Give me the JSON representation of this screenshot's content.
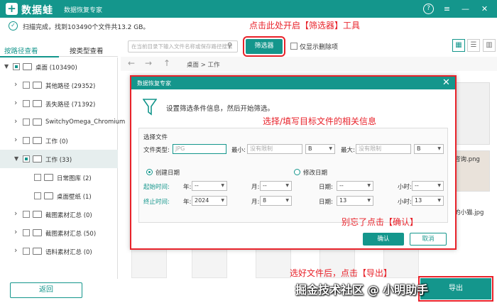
{
  "app": {
    "name": "数据蛙",
    "subtitle": "数据恢复专家",
    "logo_glyph": "+",
    "accent": "#14968c",
    "annotation_color": "#e8222a"
  },
  "window_controls": {
    "help": "?",
    "menu": "≡",
    "minimize": "—",
    "close": "✕"
  },
  "scan": {
    "status": "扫描完成，找到103490个文件共13.2 GB。"
  },
  "annotations": {
    "filter_hint": "点击此处开启【筛选器】工具",
    "fill_hint": "选择/填写目标文件的相关信息",
    "confirm_hint": "别忘了点击【确认】",
    "export_hint": "选好文件后，点击【导出】"
  },
  "watermark": "掘金技术社区 @ 小明助手",
  "sidebar": {
    "tabs": [
      {
        "label": "按路径查看",
        "active": true
      },
      {
        "label": "按类型查看",
        "active": false
      }
    ],
    "tree": [
      {
        "label": "桌面 (103490)",
        "level": 0,
        "expanded": true,
        "checked": "partial",
        "selected": false
      },
      {
        "label": "其他路径 (29352)",
        "level": 1,
        "expanded": false,
        "checked": "none",
        "selected": false
      },
      {
        "label": "丢失路径 (71392)",
        "level": 1,
        "expanded": false,
        "checked": "none",
        "selected": false
      },
      {
        "label": "SwitchyOmega_Chromium",
        "level": 1,
        "expanded": false,
        "checked": "none",
        "selected": false
      },
      {
        "label": "工作 (0)",
        "level": 1,
        "expanded": false,
        "checked": "none",
        "selected": false
      },
      {
        "label": "工作 (33)",
        "level": 1,
        "expanded": true,
        "checked": "partial",
        "selected": true
      },
      {
        "label": "日常图库 (2)",
        "level": 2,
        "expanded": false,
        "checked": "none",
        "selected": false
      },
      {
        "label": "桌面壁纸 (1)",
        "level": 2,
        "expanded": false,
        "checked": "none",
        "selected": false
      },
      {
        "label": "截图素材汇总 (0)",
        "level": 1,
        "expanded": false,
        "checked": "none",
        "selected": false
      },
      {
        "label": "截图素材汇总 (50)",
        "level": 1,
        "expanded": false,
        "checked": "none",
        "selected": false
      },
      {
        "label": "语料素材汇总 (0)",
        "level": 1,
        "expanded": false,
        "checked": "none",
        "selected": false
      }
    ],
    "back_label": "返回"
  },
  "toolbar": {
    "search_placeholder": "在当前目录下输入文件名称或保存路径搜索",
    "filter_label": "筛选器",
    "deleted_only_label": "仅显示删除项",
    "view_icons": [
      "grid-icon",
      "list-icon",
      "detail-icon"
    ]
  },
  "breadcrumb": "桌面 > 工作",
  "files": {
    "visible_names": [
      "咨询.png",
      "的小猫.jpg"
    ]
  },
  "export_label": "导出",
  "dialog": {
    "title": "数据恢复专家",
    "close": "✕",
    "intro": "设置筛选条件信息，然后开始筛选。",
    "section_title": "选择文件",
    "type_label": "文件类型:",
    "type_placeholder": "JPG",
    "min_label": "最小:",
    "min_placeholder": "没有限制",
    "min_unit": "B",
    "max_label": "最大:",
    "max_placeholder": "没有限制",
    "max_unit": "B",
    "create_date_label": "创建日期",
    "modify_date_label": "修改日期",
    "start_label": "起始时间:",
    "end_label": "终止时间:",
    "year_label": "年:",
    "month_label": "月:",
    "day_label": "日期:",
    "hour_label": "小时:",
    "start": {
      "year": "--",
      "month": "--",
      "day": "--",
      "hour": "--"
    },
    "end": {
      "year": "2024",
      "month": "8",
      "day": "13",
      "hour": "13"
    },
    "ok_label": "确认",
    "cancel_label": "取消"
  }
}
